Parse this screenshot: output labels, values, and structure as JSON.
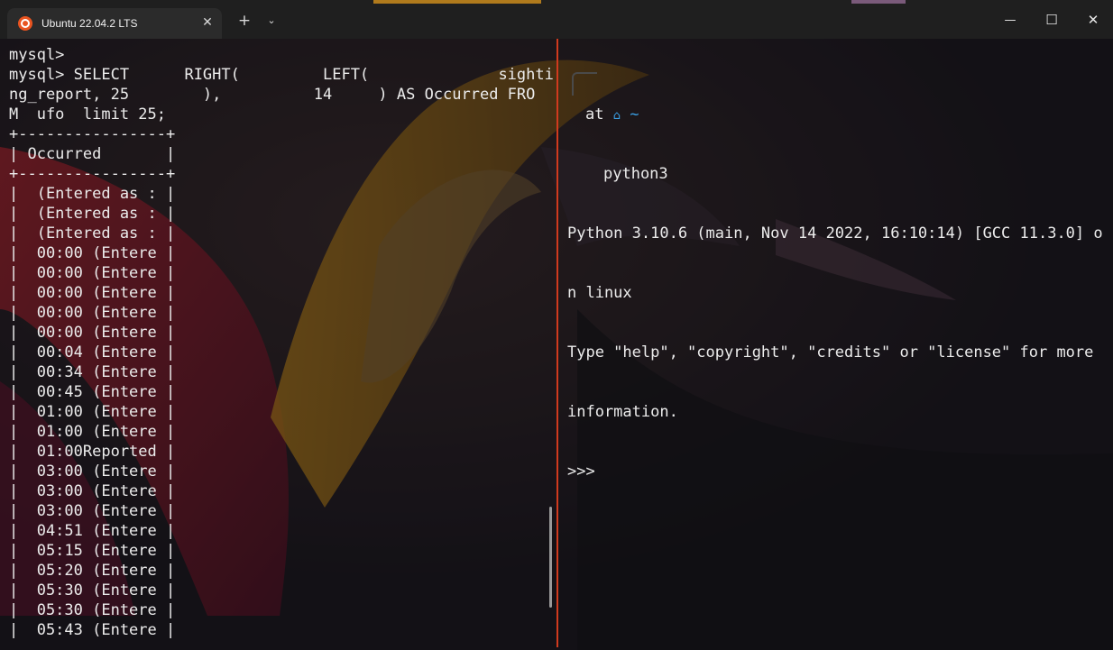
{
  "window": {
    "tab_title": "Ubuntu 22.04.2 LTS",
    "tab_icon": "ubuntu-icon",
    "new_tab_label": "+",
    "dropdown_label": "⌄",
    "close_tab_label": "✕",
    "minimize_label": "—",
    "maximize_label": "☐",
    "close_label": "✕",
    "divider_color": "#d13a1e"
  },
  "left_pane": {
    "lines": [
      "mysql>",
      "mysql> SELECT      RIGHT(         LEFT(              sighti",
      "ng_report, 25        ),          14     ) AS Occurred FRO",
      "M  ufo  limit 25;",
      "+----------------+",
      "| Occurred       |",
      "+----------------+",
      "|  (Entered as : |",
      "|  (Entered as : |",
      "|  (Entered as : |",
      "|  00:00 (Entere |",
      "|  00:00 (Entere |",
      "|  00:00 (Entere |",
      "|  00:00 (Entere |",
      "|  00:00 (Entere |",
      "|  00:04 (Entere |",
      "|  00:34 (Entere |",
      "|  00:45 (Entere |",
      "|  01:00 (Entere |",
      "|  01:00 (Entere |",
      "|  01:00Reported |",
      "|  03:00 (Entere |",
      "|  03:00 (Entere |",
      "|  03:00 (Entere |",
      "|  04:51 (Entere |",
      "|  05:15 (Entere |",
      "|  05:20 (Entere |",
      "|  05:30 (Entere |",
      "|  05:30 (Entere |",
      "|  05:43 (Entere |"
    ]
  },
  "right_pane": {
    "prompt_at": "at",
    "prompt_home_icon": "home-icon",
    "prompt_dir": "~",
    "command": "python3",
    "lines": [
      "Python 3.10.6 (main, Nov 14 2022, 16:10:14) [GCC 11.3.0] o",
      "n linux",
      "Type \"help\", \"copyright\", \"credits\" or \"license\" for more",
      "information.",
      ">>>"
    ]
  }
}
